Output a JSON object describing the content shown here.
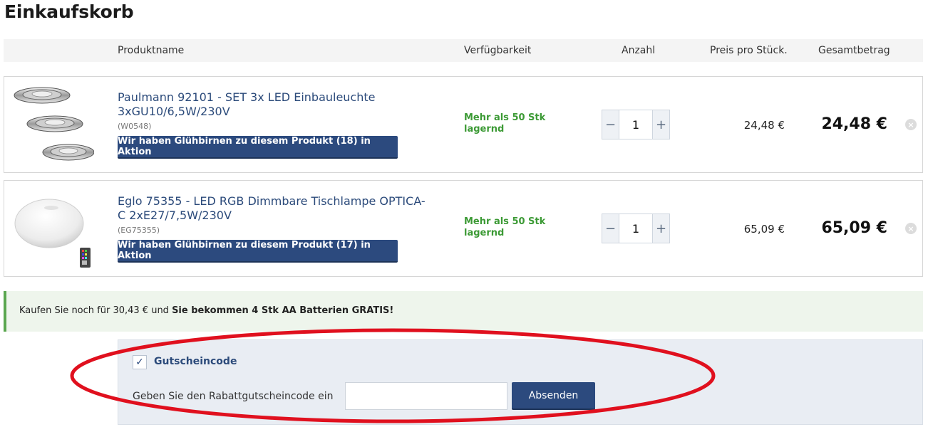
{
  "page": {
    "title": "Einkaufskorb"
  },
  "table_header": {
    "product_name": "Produktname",
    "availability": "Verfügbarkeit",
    "quantity": "Anzahl",
    "unit_price": "Preis pro Stück.",
    "total": "Gesamtbetrag"
  },
  "items": [
    {
      "name": "Paulmann 92101 - SET 3x LED Einbauleuchte 3xGU10/6,5W/230V",
      "sku": "(W0548)",
      "promo_button": "Wir haben Glühbirnen zu diesem Produkt (18) in Aktion",
      "availability": "Mehr als 50 Stk lagernd",
      "quantity": "1",
      "unit_price": "24,48 €",
      "total": "24,48 €"
    },
    {
      "name": "Eglo 75355 - LED RGB Dimmbare Tischlampe OPTICA-C 2xE27/7,5W/230V",
      "sku": "(EG75355)",
      "promo_button": "Wir haben Glühbirnen zu diesem Produkt (17) in Aktion",
      "availability": "Mehr als 50 Stk lagernd",
      "quantity": "1",
      "unit_price": "65,09 €",
      "total": "65,09 €"
    }
  ],
  "qty_controls": {
    "minus": "−",
    "plus": "+"
  },
  "remove_icon": "×",
  "notice": {
    "prefix": "Kaufen Sie noch für 30,43 € und ",
    "bold": "Sie bekommen 4 Stk AA Batterien GRATIS!"
  },
  "voucher": {
    "checkbox_checked": true,
    "checkbox_glyph": "✓",
    "checkbox_label": "Gutscheincode",
    "field_label": "Geben Sie den Rabattgutscheincode ein",
    "field_value": "",
    "submit_label": "Absenden"
  },
  "colors": {
    "accent_blue": "#2c4a7e",
    "stock_green": "#3c9a35",
    "annotation_red": "#e0101e"
  }
}
